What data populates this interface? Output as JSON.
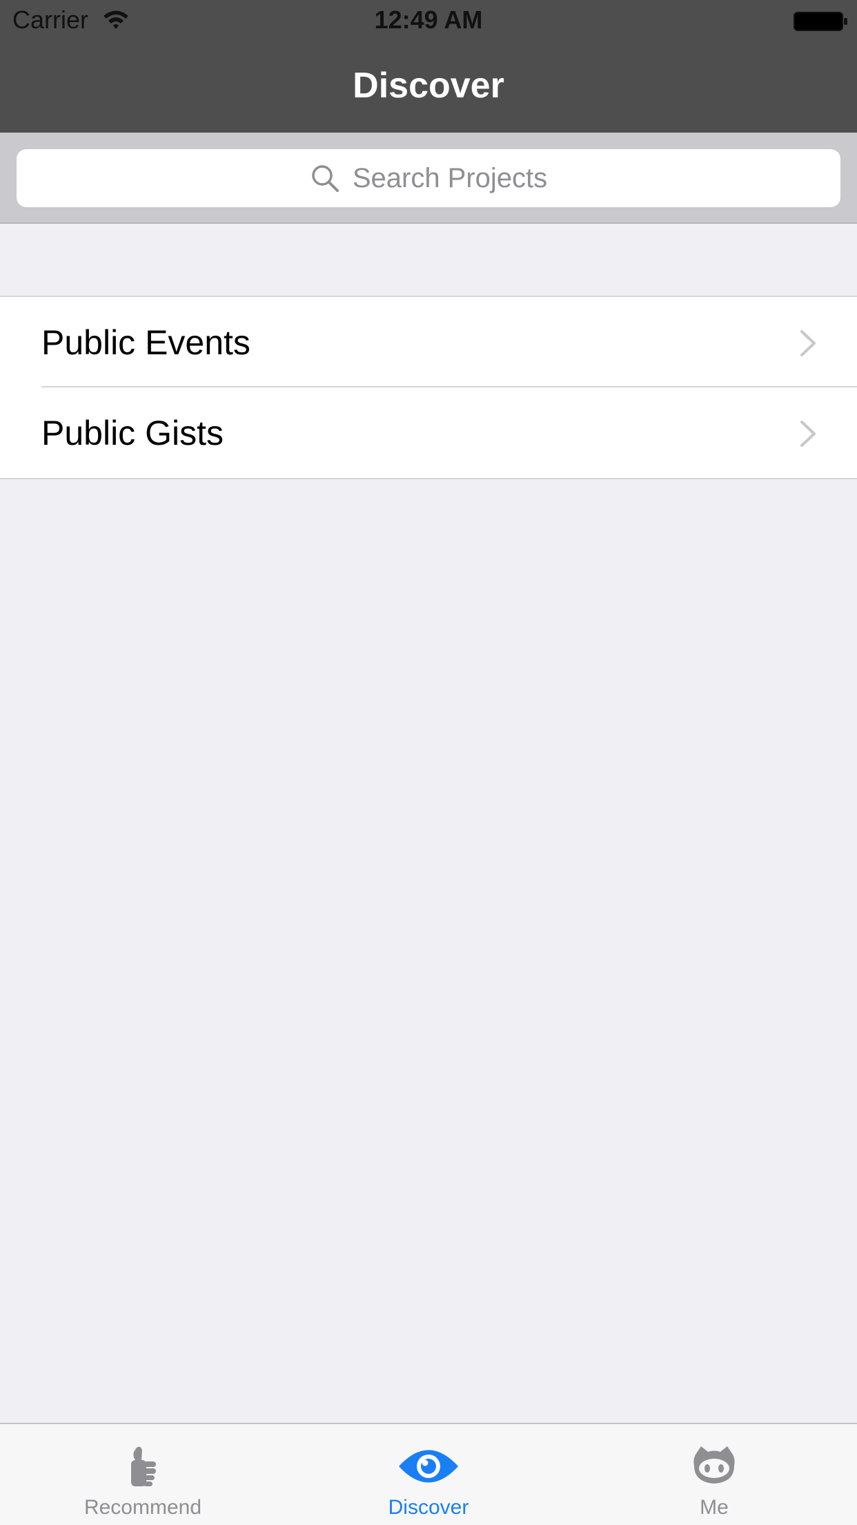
{
  "status_bar": {
    "carrier": "Carrier",
    "time": "12:49 AM"
  },
  "nav": {
    "title": "Discover"
  },
  "search": {
    "placeholder": "Search Projects"
  },
  "list": {
    "items": [
      {
        "label": "Public Events"
      },
      {
        "label": "Public Gists"
      }
    ]
  },
  "tabs": [
    {
      "label": "Recommend",
      "icon": "thumbs-up-icon",
      "active": false
    },
    {
      "label": "Discover",
      "icon": "eye-icon",
      "active": true
    },
    {
      "label": "Me",
      "icon": "octocat-icon",
      "active": false
    }
  ],
  "colors": {
    "nav_background": "#4e4e4e",
    "accent": "#1a7ff5",
    "background": "#efeff4",
    "inactive": "#8e8e93"
  }
}
